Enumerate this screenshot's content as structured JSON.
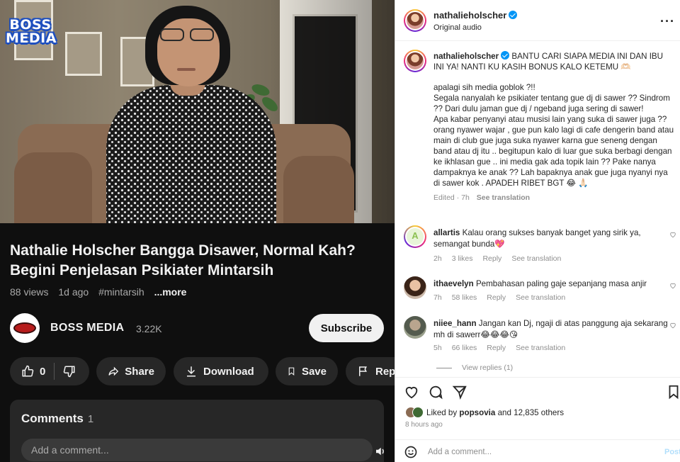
{
  "video": {
    "channel_watermark": [
      "BOSS",
      "MEDIA"
    ],
    "title": "Nathalie Holscher Bangga Disawer, Normal Kah? Begini Penjelasan Psikiater Mintarsih",
    "views": "88 views",
    "age": "1d ago",
    "hashtag": "#mintarsih",
    "more": "...more",
    "channel_name": "BOSS MEDIA",
    "subscribers": "3.22K",
    "subscribe_label": "Subscribe",
    "like_count": "0",
    "share_label": "Share",
    "download_label": "Download",
    "save_label": "Save",
    "report_label": "Report",
    "comments_label": "Comments",
    "comments_count": "1",
    "comment_placeholder": "Add a comment..."
  },
  "post": {
    "username": "nathalieholscher",
    "audio": "Original audio",
    "caption_line1": "BANTU CARI SIAPA MEDIA INI DAN IBU INI YA! NANTI KU KASIH BONUS KALO KETEMU 🫶🏻",
    "caption_body": [
      "apalagi sih media goblok ?!!",
      "Segala nanyalah ke psikiater tentang gue dj di sawer ?? Sindrom ?? Dari dulu jaman gue dj / ngeband juga sering di sawer!",
      "Apa kabar penyanyi atau musisi lain yang suka di sawer juga ?? orang nyawer wajar , gue pun kalo lagi di cafe dengerin band atau main di club gue juga suka nyawer karna gue seneng dengan band atau dj itu .. begitupun kalo di luar gue suka berbagi dengan ke ikhlasan gue .. ini media gak ada topik lain ?? Pake nanya dampaknya ke anak ?? Lah bapaknya anak gue juga nyanyi nya di sawer kok . APADEH RIBET BGT 😂 🙏🏻"
    ],
    "caption_meta": {
      "edited": "Edited · 7h",
      "translate": "See translation"
    },
    "comments": [
      {
        "user": "allartis",
        "text": "Kalau orang sukses banyak banget yang sirik ya, semangat bunda💖",
        "time": "2h",
        "likes": "3 likes",
        "reply": "Reply",
        "translate": "See translation"
      },
      {
        "user": "ithaevelyn",
        "text": "Pembahasan paling gaje sepanjang masa anjir",
        "time": "7h",
        "likes": "58 likes",
        "reply": "Reply",
        "translate": "See translation"
      },
      {
        "user": "niiee_hann",
        "text": "Jangan kan Dj, ngaji di atas panggung aja sekarang mh di sawerr😂😂😂😘",
        "time": "5h",
        "likes": "66 likes",
        "reply": "Reply",
        "translate": "See translation"
      }
    ],
    "view_replies": "View replies (1)",
    "liked_by_prefix": "Liked by",
    "liked_by_user": "popsovia",
    "liked_by_suffix": "and 12,835 others",
    "time_ago": "8 hours ago",
    "add_comment_placeholder": "Add a comment...",
    "post_label": "Post"
  },
  "colors": {
    "yt_bg": "#0f0f0f",
    "yt_pill": "#272727",
    "ig_verified": "#0095f6",
    "ig_heart": "#ed4956"
  }
}
